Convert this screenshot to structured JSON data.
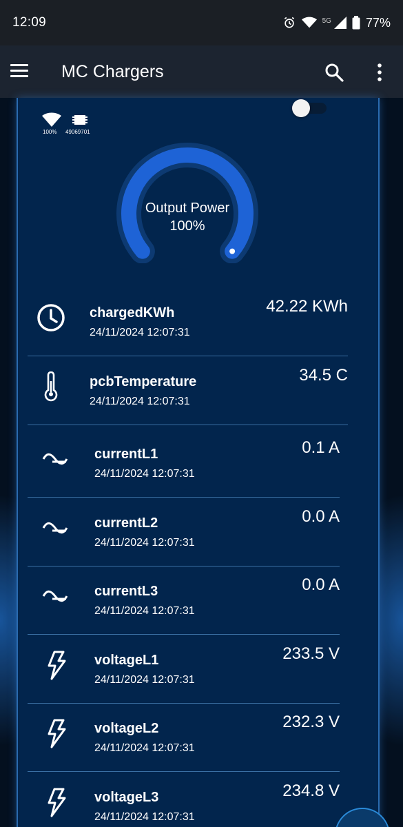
{
  "status": {
    "time": "12:09",
    "network": "5G",
    "battery": "77%"
  },
  "appbar": {
    "title": "MC Chargers",
    "icons": [
      "menu-icon",
      "search-icon",
      "more-vert-icon"
    ]
  },
  "device": {
    "wifi_signal": "100%",
    "device_id": "49069701",
    "enabled": true
  },
  "gauge": {
    "label": "Output Power",
    "value_text": "100%",
    "value_fraction": 1.0
  },
  "readings": [
    {
      "icon": "clock-icon",
      "name": "chargedKWh",
      "timestamp": "24/11/2024 12:07:31",
      "value": "42.22 KWh"
    },
    {
      "icon": "thermometer-icon",
      "name": "pcbTemperature",
      "timestamp": "24/11/2024 12:07:31",
      "value": "34.5 C"
    },
    {
      "icon": "sine-wave-icon",
      "name": "currentL1",
      "timestamp": "24/11/2024 12:07:31",
      "value": "0.1 A"
    },
    {
      "icon": "sine-wave-icon",
      "name": "currentL2",
      "timestamp": "24/11/2024 12:07:31",
      "value": "0.0 A"
    },
    {
      "icon": "sine-wave-icon",
      "name": "currentL3",
      "timestamp": "24/11/2024 12:07:31",
      "value": "0.0 A"
    },
    {
      "icon": "lightning-icon",
      "name": "voltageL1",
      "timestamp": "24/11/2024 12:07:31",
      "value": "233.5 V"
    },
    {
      "icon": "lightning-icon",
      "name": "voltageL2",
      "timestamp": "24/11/2024 12:07:31",
      "value": "232.3 V"
    },
    {
      "icon": "lightning-icon",
      "name": "voltageL3",
      "timestamp": "24/11/2024 12:07:31",
      "value": "234.8 V"
    }
  ],
  "colors": {
    "card_bg": "#02254d",
    "gauge_fill": "#1e63d6",
    "appbar_bg": "#1c2430"
  }
}
